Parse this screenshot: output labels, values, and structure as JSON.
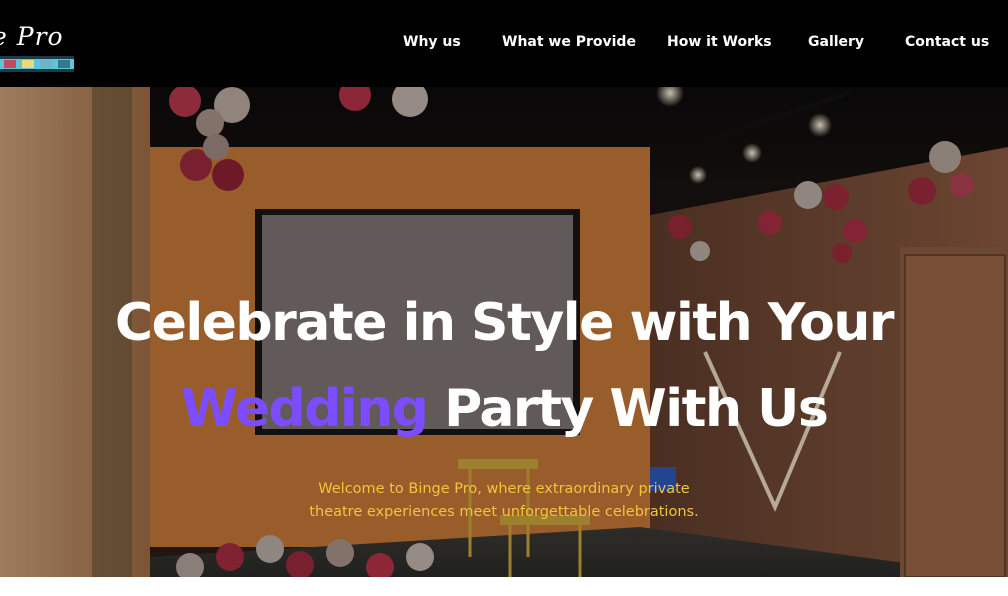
{
  "brand": {
    "logo_text": "e Pro"
  },
  "nav": {
    "items": [
      {
        "label": "Why us"
      },
      {
        "label": "What we Provide"
      },
      {
        "label": "How it Works"
      },
      {
        "label": "Gallery"
      },
      {
        "label": "Contact us"
      }
    ]
  },
  "hero": {
    "headline_line1": "Celebrate in Style with Your",
    "headline_accent": "Wedding",
    "headline_line2_rest": " Party With Us",
    "subtext_line1": "Welcome to Binge Pro, where extraordinary private",
    "subtext_line2": "theatre experiences meet unforgettable celebrations."
  },
  "colors": {
    "navbar_bg": "#000000",
    "nav_text": "#ffffff",
    "headline_text": "#ffffff",
    "accent": "#7b4dff",
    "subtext": "#f2c43d"
  }
}
